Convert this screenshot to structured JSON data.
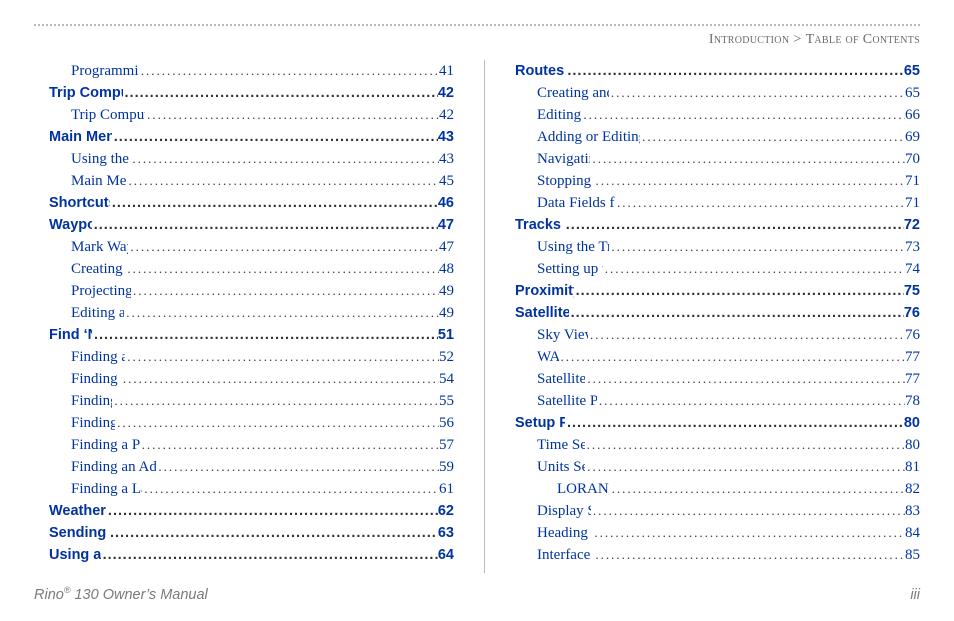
{
  "header": {
    "section": "Introduction",
    "sep": ">",
    "page": "Table of Contents"
  },
  "columns": {
    "left": [
      {
        "label": "Programming Data Fields",
        "page": "41",
        "level": 1
      },
      {
        "label": "Trip Computer Page",
        "page": "42",
        "level": 0,
        "section": true
      },
      {
        "label": "Trip Computer Page Options",
        "page": "42",
        "level": 1
      },
      {
        "label": "Main Menu Page",
        "page": "43",
        "level": 0,
        "section": true
      },
      {
        "label": "Using the Main Menu",
        "page": "43",
        "level": 1
      },
      {
        "label": "Main Menu Options",
        "page": "45",
        "level": 1
      },
      {
        "label": "Shortcuts Menu",
        "page": "46",
        "level": 0,
        "section": true
      },
      {
        "label": "Waypoints",
        "page": "47",
        "level": 0,
        "section": true
      },
      {
        "label": "Mark Waypoint Page",
        "page": "47",
        "level": 1
      },
      {
        "label": "Creating Waypoints",
        "page": "48",
        "level": 1
      },
      {
        "label": "Projecting a Waypoint",
        "page": "49",
        "level": 1
      },
      {
        "label": "Editing a Waypoint",
        "page": "49",
        "level": 1
      },
      {
        "label": "Find ‘N Go",
        "page": "51",
        "level": 0,
        "section": true
      },
      {
        "label": "Finding a Waypoint",
        "page": "52",
        "level": 1
      },
      {
        "label": "Finding a Contact",
        "page": "54",
        "level": 1
      },
      {
        "label": "Finding a City",
        "page": "55",
        "level": 1
      },
      {
        "label": "Finding an Exit",
        "page": "56",
        "level": 1
      },
      {
        "label": "Finding a Point of Interest",
        "page": "57",
        "level": 1
      },
      {
        "label": "Finding an Address or Intersection",
        "page": "59",
        "level": 1
      },
      {
        "label": "Finding a Last Found Place",
        "page": "61",
        "level": 1
      },
      {
        "label": "Weather Radio",
        "page": "62",
        "level": 0,
        "section": true
      },
      {
        "label": "Sending a Note",
        "page": "63",
        "level": 0,
        "section": true
      },
      {
        "label": "Using a Goto",
        "page": "64",
        "level": 0,
        "section": true
      }
    ],
    "right": [
      {
        "label": "Routes Page",
        "page": "65",
        "level": 0,
        "section": true
      },
      {
        "label": "Creating and Using a Route",
        "page": "65",
        "level": 1
      },
      {
        "label": "Editing a Route",
        "page": "66",
        "level": 1
      },
      {
        "label": "Adding or Editing from the Route Map Page",
        "page": "69",
        "level": 1
      },
      {
        "label": "Navigating a Route",
        "page": "70",
        "level": 1
      },
      {
        "label": "Stopping Navigation",
        "page": "71",
        "level": 1
      },
      {
        "label": "Data Fields for the Route Page",
        "page": "71",
        "level": 1
      },
      {
        "label": "Tracks Page",
        "page": "72",
        "level": 0,
        "section": true
      },
      {
        "label": "Using the TracBack Feature",
        "page": "73",
        "level": 1
      },
      {
        "label": "Setting up the Track Log",
        "page": "74",
        "level": 1
      },
      {
        "label": "Proximity Page",
        "page": "75",
        "level": 0,
        "section": true
      },
      {
        "label": "Satellite Page",
        "page": "76",
        "level": 0,
        "section": true
      },
      {
        "label": "Sky View Graphic",
        "page": "76",
        "level": 1
      },
      {
        "label": "WAAS",
        "page": "77",
        "level": 1
      },
      {
        "label": "Satellite Strength",
        "page": "77",
        "level": 1
      },
      {
        "label": "Satellite Page Options",
        "page": "78",
        "level": 1
      },
      {
        "label": "Setup Pages",
        "page": "80",
        "level": 0,
        "section": true
      },
      {
        "label": "Time Setup Page",
        "page": "80",
        "level": 1
      },
      {
        "label": "Units Setup Page",
        "page": "81",
        "level": 1
      },
      {
        "label": "LORAN TD Format",
        "page": "82",
        "level": 2
      },
      {
        "label": "Display Setup Page",
        "page": "83",
        "level": 1
      },
      {
        "label": "Heading Setup Page",
        "page": "84",
        "level": 1
      },
      {
        "label": "Interface Setup Page",
        "page": "85",
        "level": 1
      }
    ]
  },
  "footer": {
    "product": "Rino",
    "reg": "®",
    "title_rest": " 130 Owner’s Manual",
    "page_number": "iii"
  }
}
